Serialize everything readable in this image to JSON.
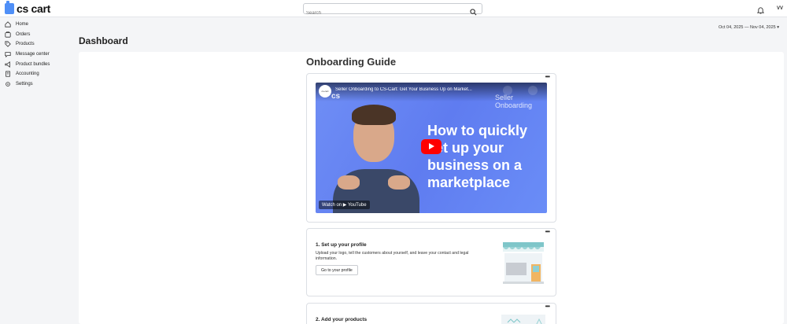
{
  "header": {
    "logo_text": "cs cart",
    "search_placeholder": "Search",
    "avatar_initials": "VV",
    "accent_color": "#4f8ff7"
  },
  "sidebar": {
    "items": [
      {
        "label": "Home",
        "icon": "home-icon"
      },
      {
        "label": "Orders",
        "icon": "orders-icon"
      },
      {
        "label": "Products",
        "icon": "tag-icon"
      },
      {
        "label": "Message center",
        "icon": "chat-icon"
      },
      {
        "label": "Product bundles",
        "icon": "megaphone-icon"
      },
      {
        "label": "Accounting",
        "icon": "ledger-icon"
      },
      {
        "label": "Settings",
        "icon": "gear-icon"
      }
    ]
  },
  "page": {
    "title": "Dashboard",
    "date_range": "Oct 04, 2025 — Nov 04, 2025 ▾"
  },
  "onboarding": {
    "title": "Onboarding Guide",
    "video": {
      "title": "Seller Onboarding to CS-Cart: Get Your Business Up on Market...",
      "channel_label": "cs-cart",
      "brand": "cs",
      "brand_right": "Seller Onboarding",
      "headline": "How to quickly set up your business on a marketplace",
      "watch_on": "Watch on",
      "platform": "YouTube"
    },
    "steps": [
      {
        "title": "1. Set up your profile",
        "description": "Upload your logo, tell the customers about yourself, and leave your contact and legal information.",
        "button": "Go to your profile"
      },
      {
        "title": "2. Add your products"
      }
    ]
  }
}
